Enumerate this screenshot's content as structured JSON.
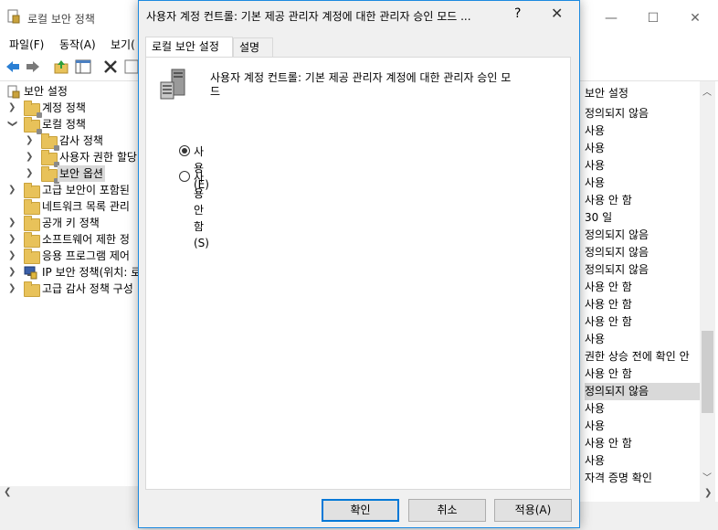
{
  "app": {
    "title": "로컬 보안 정책",
    "menu": [
      "파일(F)",
      "동작(A)",
      "보기("
    ]
  },
  "tree": [
    {
      "label": "보안 설정",
      "indent": 0,
      "expanded": true,
      "icon": "security-settings-icon"
    },
    {
      "label": "계정 정책",
      "indent": 1,
      "expanded": false,
      "icon": "folder-icon"
    },
    {
      "label": "로컬 정책",
      "indent": 1,
      "expanded": true,
      "icon": "folder-icon"
    },
    {
      "label": "감사 정책",
      "indent": 2,
      "expanded": false,
      "icon": "folder-icon"
    },
    {
      "label": "사용자 권한 할당",
      "indent": 2,
      "expanded": false,
      "icon": "folder-icon"
    },
    {
      "label": "보안 옵션",
      "indent": 2,
      "expanded": false,
      "icon": "folder-icon",
      "selected": true
    },
    {
      "label": "고급 보안이 포함된",
      "indent": 1,
      "expanded": false,
      "icon": "folder-icon"
    },
    {
      "label": "네트워크 목록 관리",
      "indent": 1,
      "expanded": null,
      "icon": "folder-icon"
    },
    {
      "label": "공개 키 정책",
      "indent": 1,
      "expanded": false,
      "icon": "folder-icon"
    },
    {
      "label": "소프트웨어 제한 정",
      "indent": 1,
      "expanded": false,
      "icon": "folder-icon"
    },
    {
      "label": "응용 프로그램 제어",
      "indent": 1,
      "expanded": false,
      "icon": "folder-icon"
    },
    {
      "label": "IP 보안 정책(위치: 로",
      "indent": 1,
      "expanded": false,
      "icon": "ip-security-icon"
    },
    {
      "label": "고급 감사 정책 구성",
      "indent": 1,
      "expanded": false,
      "icon": "folder-icon"
    }
  ],
  "list": {
    "header": "보안 설정",
    "rows": [
      "정의되지 않음",
      "사용",
      "사용",
      "사용",
      "사용",
      "사용 안 함",
      "30 일",
      "정의되지 않음",
      "정의되지 않음",
      "정의되지 않음",
      "사용 안 함",
      "사용 안 함",
      "사용 안 함",
      "사용",
      "권한 상승 전에 확인 안",
      "사용 안 함",
      "정의되지 않음",
      "사용",
      "사용",
      "사용 안 함",
      "사용",
      "자격 증명 확인"
    ],
    "selected_index": 16
  },
  "dialog": {
    "title": "사용자 계정 컨트롤: 기본 제공 관리자 계정에 대한 관리자 승인 모드 ...",
    "help": "?",
    "close": "✕",
    "tabs": [
      "로컬 보안 설정",
      "설명"
    ],
    "policy_name_line1": "사용자 계정 컨트롤: 기본 제공 관리자 계정에 대한 관리자 승인 모",
    "policy_name_line2": "드",
    "options": [
      {
        "label": "사용(E)",
        "checked": true
      },
      {
        "label": "사용 안 함(S)",
        "checked": false
      }
    ],
    "buttons": {
      "ok": "확인",
      "cancel": "취소",
      "apply": "적용(A)"
    }
  }
}
